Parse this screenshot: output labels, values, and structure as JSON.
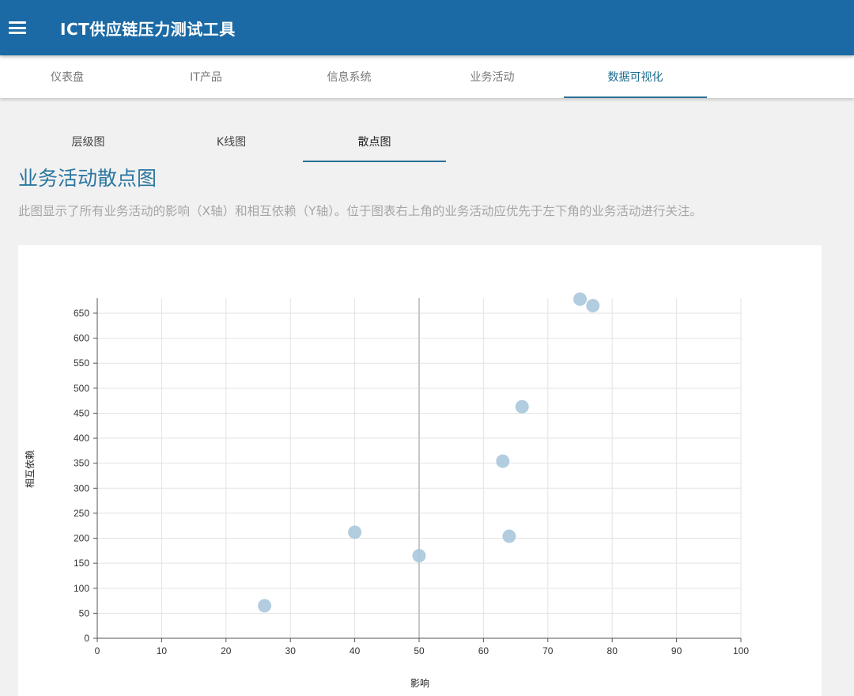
{
  "app": {
    "title": "ICT供应链压力测试工具",
    "menu_icon": "hamburger-menu-icon"
  },
  "nav": {
    "tabs": [
      {
        "label": "仪表盘"
      },
      {
        "label": "IT产品"
      },
      {
        "label": "信息系统"
      },
      {
        "label": "业务活动"
      },
      {
        "label": "数据可视化",
        "active": true
      }
    ]
  },
  "subnav": {
    "tabs": [
      {
        "label": "层级图"
      },
      {
        "label": "K线图"
      },
      {
        "label": "散点图",
        "active": true
      }
    ]
  },
  "page": {
    "title": "业务活动散点图",
    "description": "此图显示了所有业务活动的影响（X轴）和相互依赖（Y轴）。位于图表右上角的业务活动应优先于左下角的业务活动进行关注。"
  },
  "colors": {
    "appbar": "#1b6aa5",
    "accent": "#2a7196",
    "point": "#a9c8dc"
  },
  "chart_data": {
    "type": "scatter",
    "xlabel": "影响",
    "ylabel": "相互依赖",
    "xlim": [
      0,
      100
    ],
    "ylim": [
      0,
      680
    ],
    "x_ticks": [
      0,
      10,
      20,
      30,
      40,
      50,
      60,
      70,
      80,
      90,
      100
    ],
    "y_ticks": [
      0,
      50,
      100,
      150,
      200,
      250,
      300,
      350,
      400,
      450,
      500,
      550,
      600,
      650
    ],
    "grid": true,
    "reference_line_x": 50,
    "points": [
      {
        "x": 26,
        "y": 65
      },
      {
        "x": 40,
        "y": 212
      },
      {
        "x": 50,
        "y": 165
      },
      {
        "x": 63,
        "y": 354
      },
      {
        "x": 64,
        "y": 204
      },
      {
        "x": 66,
        "y": 463
      },
      {
        "x": 75,
        "y": 678
      },
      {
        "x": 77,
        "y": 665
      }
    ]
  }
}
